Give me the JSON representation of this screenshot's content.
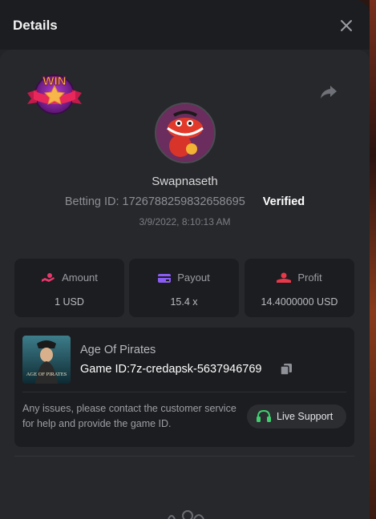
{
  "modal": {
    "title": "Details"
  },
  "badge": {
    "text": "WIN"
  },
  "player": {
    "username": "Swapnaseth",
    "betting_id_label": "Betting ID: 1726788259832658695",
    "verified_label": "Verified",
    "timestamp": "3/9/2022, 8:10:13 AM"
  },
  "stats": [
    {
      "label": "Amount",
      "value": "1 USD",
      "icon": "coins-icon",
      "color": "#e8386b"
    },
    {
      "label": "Payout",
      "value": "15.4 x",
      "icon": "card-icon",
      "color": "#8a5cf5"
    },
    {
      "label": "Profit",
      "value": "14.4000000 USD",
      "icon": "profit-icon",
      "color": "#e8384a"
    }
  ],
  "game": {
    "name": "Age Of Pirates",
    "game_id": "Game ID:7z-credapsk-5637946769",
    "thumb_text": "AGE OF PIRATES"
  },
  "support": {
    "help_text": "Any issues, please contact the customer service for help and provide the game ID.",
    "button_label": "Live Support",
    "accent": "#3fcf6e"
  }
}
